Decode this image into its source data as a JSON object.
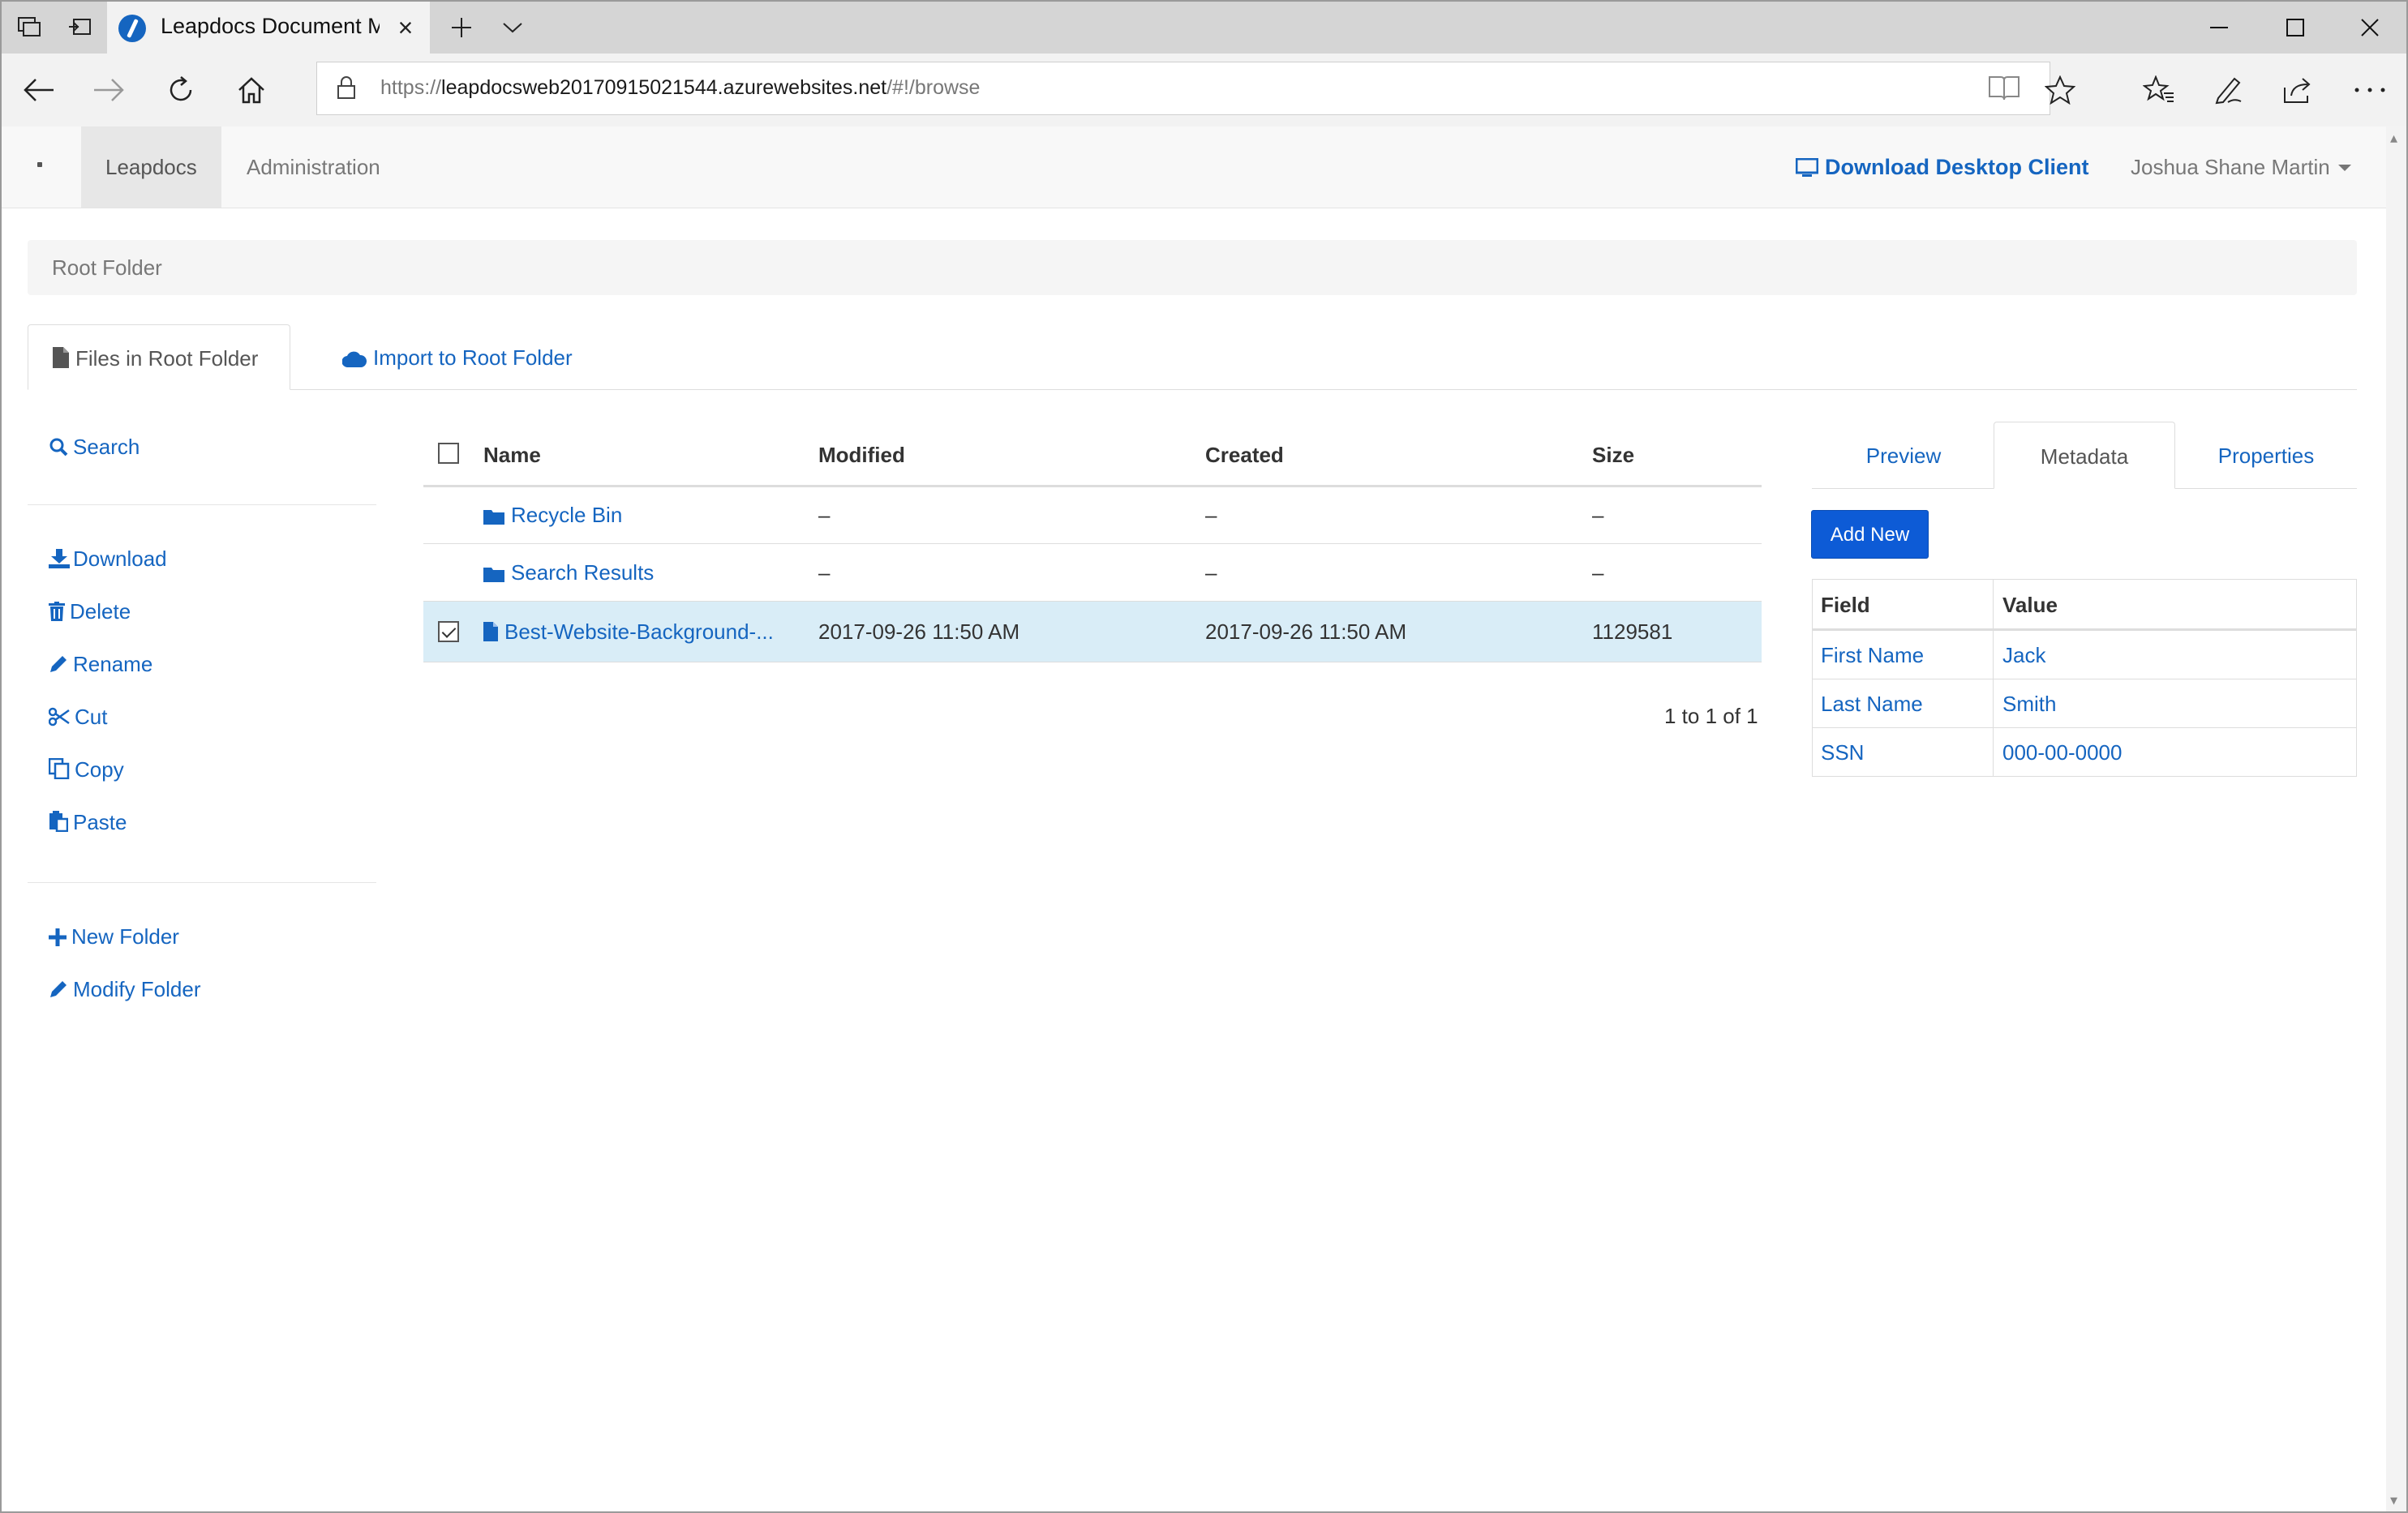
{
  "browser": {
    "tab_title": "Leapdocs Document Ma",
    "url_prefix": "https://",
    "url_host": "leapdocsweb20170915021544.azurewebsites.net",
    "url_path": "/#!/browse"
  },
  "nav": {
    "brand": "·",
    "items": [
      {
        "label": "Leapdocs",
        "active": true
      },
      {
        "label": "Administration",
        "active": false
      }
    ],
    "download_client": "Download Desktop Client",
    "user_name": "Joshua Shane Martin"
  },
  "breadcrumb": "Root Folder",
  "folder_tabs": {
    "files": "Files in Root Folder",
    "import": "Import to Root Folder"
  },
  "sidebar": {
    "search": "Search",
    "actions": [
      "Download",
      "Delete",
      "Rename",
      "Cut",
      "Copy",
      "Paste"
    ],
    "folder_actions": [
      "New Folder",
      "Modify Folder"
    ]
  },
  "files_table": {
    "columns": [
      "Name",
      "Modified",
      "Created",
      "Size"
    ],
    "rows": [
      {
        "type": "folder",
        "name": "Recycle Bin",
        "modified": "–",
        "created": "–",
        "size": "–",
        "selected": false
      },
      {
        "type": "folder",
        "name": "Search Results",
        "modified": "–",
        "created": "–",
        "size": "–",
        "selected": false
      },
      {
        "type": "file",
        "name": "Best-Website-Background-...",
        "modified": "2017-09-26 11:50 AM",
        "created": "2017-09-26 11:50 AM",
        "size": "1129581",
        "selected": true
      }
    ],
    "pager": "1 to 1 of 1"
  },
  "detail_panel": {
    "tabs": [
      {
        "label": "Preview",
        "active": false
      },
      {
        "label": "Metadata",
        "active": true
      },
      {
        "label": "Properties",
        "active": false
      }
    ],
    "add_new": "Add New",
    "columns": [
      "Field",
      "Value"
    ],
    "rows": [
      {
        "field": "First Name",
        "value": "Jack"
      },
      {
        "field": "Last Name",
        "value": "Smith"
      },
      {
        "field": "SSN",
        "value": "000-00-0000"
      }
    ]
  },
  "colors": {
    "link": "#1565c0",
    "primary_button": "#0d5bd6",
    "selected_row": "#d9edf7"
  }
}
